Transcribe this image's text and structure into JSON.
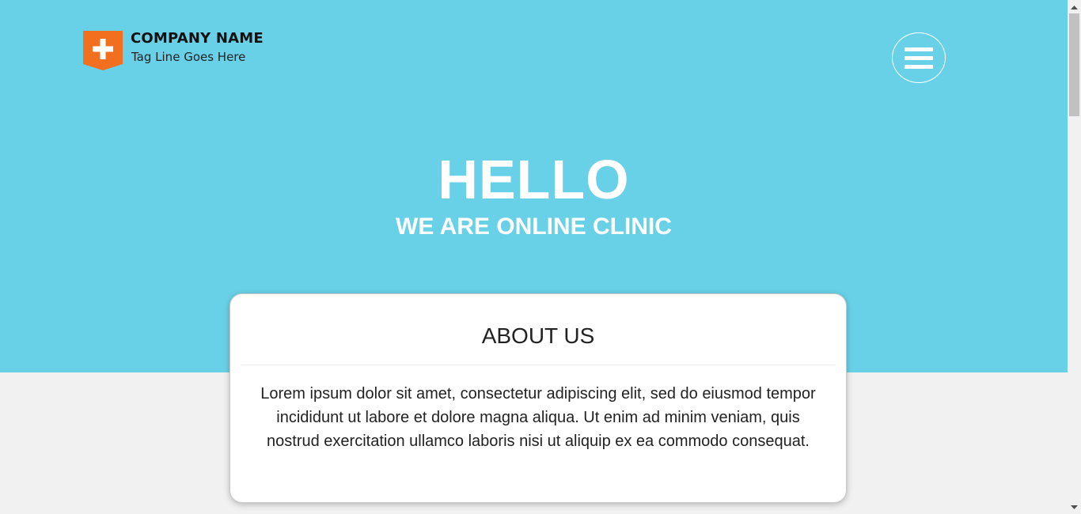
{
  "brand": {
    "name": "COMPANY NAME",
    "tagline": "Tag Line Goes Here",
    "logo_icon": "medical-cross-badge-icon",
    "logo_color": "#f26f1f"
  },
  "nav": {
    "menu_icon": "hamburger-menu-icon"
  },
  "hero": {
    "title": "HELLO",
    "subtitle": "WE ARE ONLINE CLINIC",
    "background": "#69d1e7"
  },
  "about": {
    "title": "ABOUT US",
    "body": "Lorem ipsum dolor sit amet, consectetur adipiscing elit, sed do eiusmod tempor incididunt ut labore et dolore magna aliqua. Ut enim ad minim veniam, quis nostrud exercitation ullamco laboris nisi ut aliquip ex ea commodo consequat."
  },
  "scrollbar": {
    "up_icon": "scroll-up-arrow-icon",
    "down_icon": "scroll-down-arrow-icon"
  }
}
